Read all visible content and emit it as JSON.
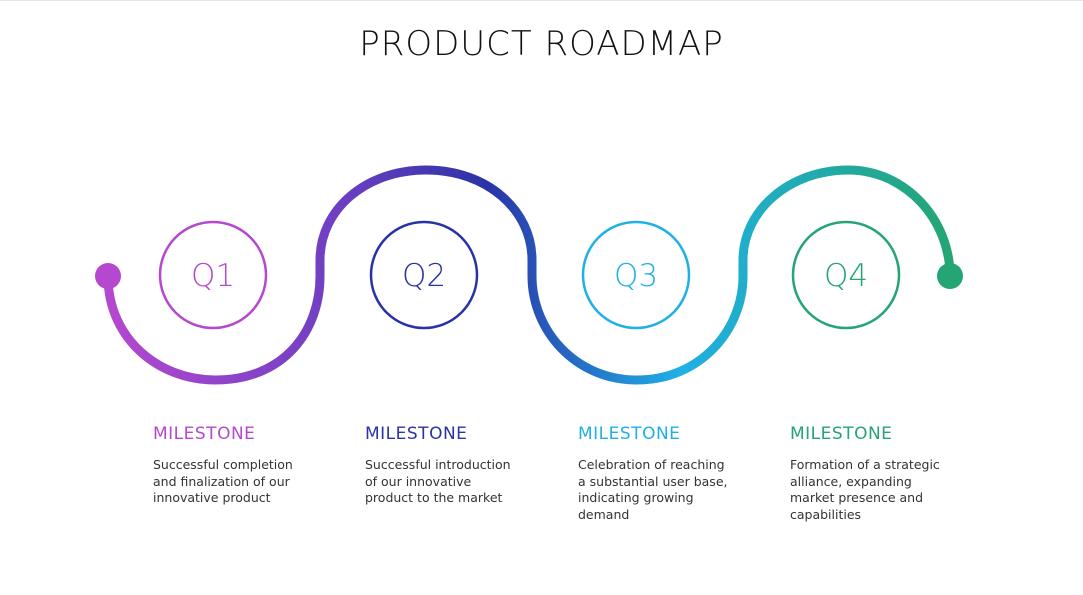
{
  "title": "PRODUCT ROADMAP",
  "colors": {
    "q1": "#b548cf",
    "q2": "#2a33a6",
    "q3": "#1fb0e6",
    "q4": "#24a573",
    "path_start": "#b548cf",
    "path_mid1": "#6b3fc2",
    "path_mid2": "#2a33a6",
    "path_mid3": "#1fb0e6",
    "path_end": "#24a573"
  },
  "quarters": [
    {
      "label": "Q1",
      "milestone_title": "MILESTONE",
      "description": "Successful completion\nand finalization of our\ninnovative product"
    },
    {
      "label": "Q2",
      "milestone_title": "MILESTONE",
      "description": "Successful introduction\nof our innovative\nproduct to the market"
    },
    {
      "label": "Q3",
      "milestone_title": "MILESTONE",
      "description": "Celebration of reaching\na substantial user base,\nindicating growing\ndemand"
    },
    {
      "label": "Q4",
      "milestone_title": "MILESTONE",
      "description": "Formation of a strategic\nalliance, expanding\nmarket presence and\ncapabilities"
    }
  ]
}
